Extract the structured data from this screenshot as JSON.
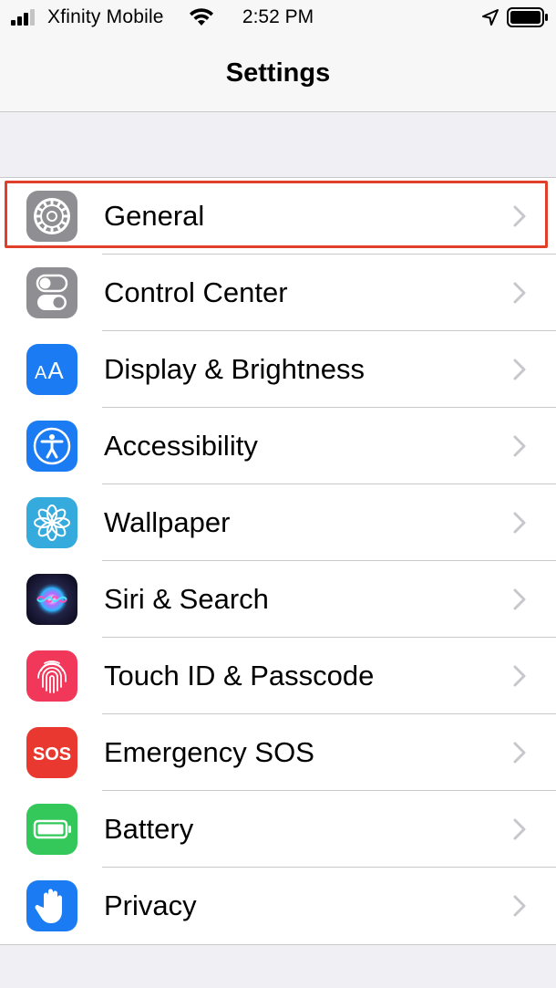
{
  "status_bar": {
    "carrier": "Xfinity Mobile",
    "time": "2:52 PM",
    "signal_bars": 3,
    "signal_icon": "signal-icon",
    "wifi_icon": "wifi-icon",
    "location_icon": "location-arrow-icon",
    "battery_icon": "battery-icon"
  },
  "nav": {
    "title": "Settings"
  },
  "settings": {
    "items": [
      {
        "label": "General",
        "icon": "gear-icon",
        "icon_color": "#8e8e93",
        "highlighted": true
      },
      {
        "label": "Control Center",
        "icon": "toggles-icon",
        "icon_color": "#8e8e93"
      },
      {
        "label": "Display & Brightness",
        "icon": "text-size-icon",
        "icon_text": "AA",
        "icon_color": "#1a7bf2"
      },
      {
        "label": "Accessibility",
        "icon": "accessibility-icon",
        "icon_color": "#1a7bf2"
      },
      {
        "label": "Wallpaper",
        "icon": "flower-icon",
        "icon_color": "#35aadc"
      },
      {
        "label": "Siri & Search",
        "icon": "siri-icon",
        "icon_color": "#1c1c3a"
      },
      {
        "label": "Touch ID & Passcode",
        "icon": "fingerprint-icon",
        "icon_color": "#f2385a"
      },
      {
        "label": "Emergency SOS",
        "icon": "sos-icon",
        "icon_text": "SOS",
        "icon_color": "#e9382f"
      },
      {
        "label": "Battery",
        "icon": "battery-icon",
        "icon_color": "#34c759"
      },
      {
        "label": "Privacy",
        "icon": "hand-icon",
        "icon_color": "#1a7bf2"
      }
    ]
  },
  "colors": {
    "highlight_border": "#e0402a",
    "chevron": "#c7c7cc",
    "background": "#efeff4"
  }
}
